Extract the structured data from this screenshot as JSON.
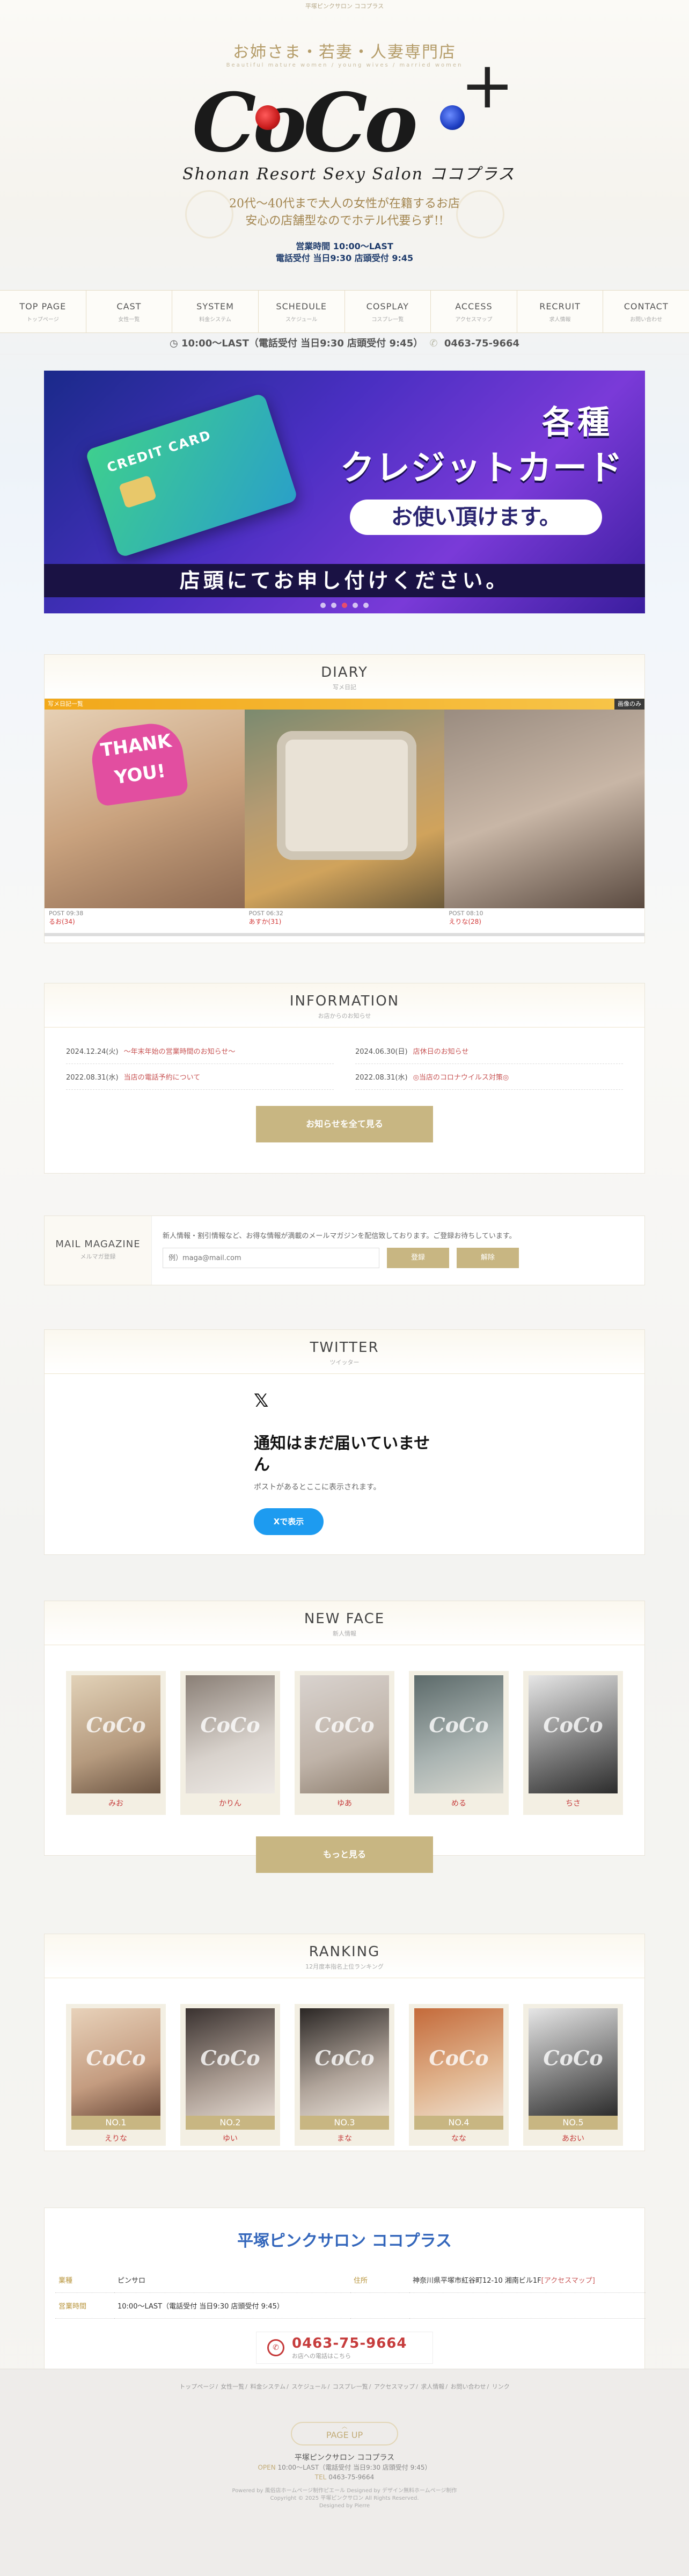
{
  "topbar": "平塚ピンクサロン ココプラス",
  "header": {
    "tagline": "お姉さま・若妻・人妻専門店",
    "tagline_sub": "Beautiful mature women / young wives / married women",
    "logo_text": "CoCo",
    "logo_plus": "+",
    "logo_sub": "Shonan Resort Sexy Salon ココプラス",
    "intro1": "20代〜40代まで大人の女性が在籍するお店",
    "intro2": "安心の店舗型なのでホテル代要らず!!",
    "hours1": "営業時間 10:00〜LAST",
    "hours2": "電話受付 当日9:30 店頭受付 9:45"
  },
  "nav": [
    {
      "en": "TOP PAGE",
      "ja": "トップページ"
    },
    {
      "en": "CAST",
      "ja": "女性一覧"
    },
    {
      "en": "SYSTEM",
      "ja": "料金システム"
    },
    {
      "en": "SCHEDULE",
      "ja": "スケジュール"
    },
    {
      "en": "COSPLAY",
      "ja": "コスプレ一覧"
    },
    {
      "en": "ACCESS",
      "ja": "アクセスマップ"
    },
    {
      "en": "RECRUIT",
      "ja": "求人情報"
    },
    {
      "en": "CONTACT",
      "ja": "お問い合わせ"
    }
  ],
  "infobar": {
    "hours": "10:00〜LAST（電話受付 当日9:30 店頭受付 9:45）",
    "tel": "0463-75-9664"
  },
  "slider": {
    "card_label": "CREDIT CARD",
    "line1": "各種",
    "line2": "クレジットカード",
    "line3": "お使い頂けます。",
    "bar": "店頭にてお申し付けください。"
  },
  "diary": {
    "title_en": "DIARY",
    "title_ja": "写メ日記",
    "tab_left": "写メ日記一覧",
    "tab_right": "画像のみ",
    "heart_text": "THANK YOU!",
    "posts": [
      {
        "time": "POST 09:38",
        "name": "るお(34)"
      },
      {
        "time": "POST 06:32",
        "name": "あすか(31)"
      },
      {
        "time": "POST 08:10",
        "name": "えりな(28)"
      }
    ]
  },
  "information": {
    "title_en": "INFORMATION",
    "title_ja": "お店からのお知らせ",
    "items": [
      {
        "date": "2024.12.24(火)",
        "title": "〜年末年始の営業時間のお知らせ〜"
      },
      {
        "date": "2024.06.30(日)",
        "title": "店休日のお知らせ"
      },
      {
        "date": "2022.08.31(水)",
        "title": "当店の電話予約について"
      },
      {
        "date": "2022.08.31(水)",
        "title": "◎当店のコロナウイルス対策◎"
      }
    ],
    "button": "お知らせを全て見る"
  },
  "mail": {
    "title_en": "MAIL MAGAZINE",
    "title_ja": "メルマガ登録",
    "desc": "新人情報・割引情報など、お得な情報が満載のメールマガジンを配信致しております。ご登録お待ちしています。",
    "placeholder": "例）maga@mail.com",
    "register": "登録",
    "cancel": "解除"
  },
  "twitter": {
    "title_en": "TWITTER",
    "title_ja": "ツイッター",
    "x": "𝕏",
    "empty_title": "通知はまだ届いていません",
    "empty_sub": "ポストがあるとここに表示されます。",
    "button": "Xで表示"
  },
  "newface": {
    "title_en": "NEW FACE",
    "title_ja": "新人情報",
    "watermark": "CoCo",
    "girls": [
      {
        "name": "みお"
      },
      {
        "name": "かりん"
      },
      {
        "name": "ゆあ"
      },
      {
        "name": "める"
      },
      {
        "name": "ちさ"
      }
    ],
    "button": "もっと見る"
  },
  "ranking": {
    "title_en": "RANKING",
    "title_ja": "12月度本指名上位ランキング",
    "girls": [
      {
        "rank": "NO.1",
        "name": "えりな"
      },
      {
        "rank": "NO.2",
        "name": "ゆい"
      },
      {
        "rank": "NO.3",
        "name": "まな"
      },
      {
        "rank": "NO.4",
        "name": "なな"
      },
      {
        "rank": "NO.5",
        "name": "あおい"
      }
    ]
  },
  "shop": {
    "title": "平塚ピンクサロン ココプラス",
    "k_type": "業種",
    "v_type": "ピンサロ",
    "k_addr": "住所",
    "v_addr": "神奈川県平塚市紅谷町12-10 湘南ビル1F",
    "v_map": "[アクセスマップ]",
    "k_hours": "営業時間",
    "v_hours": "10:00〜LAST（電話受付 当日9:30 店頭受付 9:45）",
    "tel": "0463-75-9664",
    "tel_sub": "お店への電話はこちら"
  },
  "footer": {
    "links": [
      "トップページ",
      "女性一覧",
      "料金システム",
      "スケジュール",
      "コスプレ一覧",
      "アクセスマップ",
      "求人情報",
      "お問い合わせ",
      "リンク"
    ],
    "pagetop": "PAGE UP",
    "shopname": "平塚ピンクサロン ココプラス",
    "open_label": "OPEN",
    "open": "10:00〜LAST（電話受付 当日9:30 店頭受付 9:45）",
    "tel_label": "TEL",
    "tel": "0463-75-9664",
    "credit1": "Powered by 風俗店ホームページ制作ピエール  Designed by デザイン無料ホームページ制作",
    "credit2": "Copyright © 2025 平塚ピンクサロン All Rights Reserved.",
    "credit3": "Designed by Pierre"
  },
  "colors": {
    "gold": "#c8b682",
    "red": "#c63c3c",
    "blue": "#3366bb",
    "navy": "#1d3a6b"
  }
}
